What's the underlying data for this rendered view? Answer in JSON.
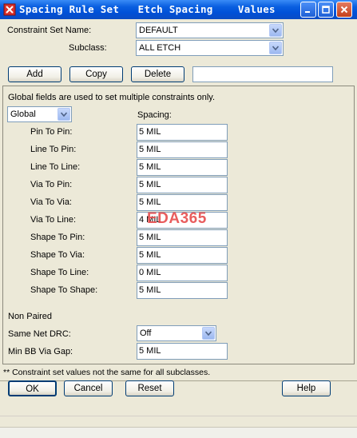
{
  "window": {
    "title": "Spacing Rule Set   Etch Spacing    Values"
  },
  "header": {
    "constraint_set_label": "Constraint Set Name:",
    "constraint_set_value": "DEFAULT",
    "subclass_label": "Subclass:",
    "subclass_value": "ALL ETCH"
  },
  "actions": {
    "add": "Add",
    "copy": "Copy",
    "delete": "Delete",
    "name_input": ""
  },
  "panel": {
    "info": "Global fields are used to set multiple constraints only.",
    "scope_value": "Global",
    "spacing_header": "Spacing:",
    "rows": [
      {
        "label": "Pin To Pin:",
        "value": "5 MIL"
      },
      {
        "label": "Line To Pin:",
        "value": "5 MIL"
      },
      {
        "label": "Line To Line:",
        "value": "5 MIL"
      },
      {
        "label": "Via To Pin:",
        "value": "5 MIL"
      },
      {
        "label": "Via To Via:",
        "value": "5 MIL"
      },
      {
        "label": "Via To Line:",
        "value": "4 MIL"
      },
      {
        "label": "Shape To Pin:",
        "value": "5 MIL"
      },
      {
        "label": "Shape To Via:",
        "value": "5 MIL"
      },
      {
        "label": "Shape To Line:",
        "value": "0 MIL"
      },
      {
        "label": "Shape To Shape:",
        "value": "5 MIL"
      }
    ],
    "non_paired_label": "Non Paired",
    "same_net_label": "Same Net DRC:",
    "same_net_value": "Off",
    "min_bb_label": "Min BB Via Gap:",
    "min_bb_value": "5 MIL"
  },
  "footnote": "** Constraint set values not the same for all subclasses.",
  "footer": {
    "ok": "OK",
    "cancel": "Cancel",
    "reset": "Reset",
    "help": "Help"
  },
  "watermark": "EDA365"
}
